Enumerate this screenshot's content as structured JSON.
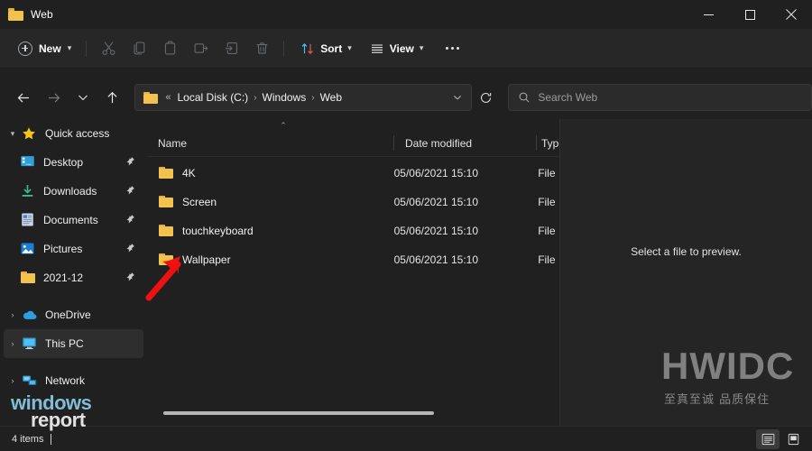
{
  "window": {
    "title": "Web",
    "title_icon": "folder-icon",
    "controls": {
      "minimize": "minimize-icon",
      "maximize": "maximize-icon",
      "close": "close-icon"
    }
  },
  "toolbar": {
    "new_label": "New",
    "new_icon": "plus-circle-icon",
    "new_chevron": "⌄",
    "actions": [
      {
        "name": "cut-button",
        "icon": "scissors-icon",
        "label": "Cut",
        "disabled": true
      },
      {
        "name": "copy-button",
        "icon": "copy-icon",
        "label": "Copy",
        "disabled": true
      },
      {
        "name": "paste-button",
        "icon": "clipboard-icon",
        "label": "Paste",
        "disabled": true
      },
      {
        "name": "rename-button",
        "icon": "rename-icon",
        "label": "Rename",
        "disabled": true
      },
      {
        "name": "share-button",
        "icon": "share-icon",
        "label": "Share",
        "disabled": true
      },
      {
        "name": "delete-button",
        "icon": "trash-icon",
        "label": "Delete",
        "disabled": true
      }
    ],
    "sort_label": "Sort",
    "sort_icon": "sort-arrows-icon",
    "view_label": "View",
    "view_icon": "list-lines-icon",
    "overflow_label": "See more",
    "overflow_icon": "ellipsis-icon"
  },
  "address": {
    "back_icon": "arrow-left-icon",
    "forward_icon": "arrow-right-icon",
    "recent_icon": "chevron-down-icon",
    "up_icon": "arrow-up-icon",
    "folder_icon": "folder-icon",
    "overflow": "«",
    "crumbs": [
      "Local Disk (C:)",
      "Windows",
      "Web"
    ],
    "separator": "›",
    "dropdown_icon": "chevron-down-icon",
    "refresh_icon": "refresh-icon"
  },
  "search": {
    "icon": "search-icon",
    "placeholder": "Search Web",
    "value": ""
  },
  "sidebar": {
    "items": [
      {
        "label": "Quick access",
        "icon": "star-icon",
        "expander": "⌄",
        "expanded": true,
        "pinned": false,
        "child": false,
        "selected": false
      },
      {
        "label": "Desktop",
        "icon": "desktop-icon",
        "expander": "",
        "pinned": true,
        "child": true,
        "selected": false
      },
      {
        "label": "Downloads",
        "icon": "download-icon",
        "expander": "",
        "pinned": true,
        "child": true,
        "selected": false
      },
      {
        "label": "Documents",
        "icon": "document-icon",
        "expander": "",
        "pinned": true,
        "child": true,
        "selected": false
      },
      {
        "label": "Pictures",
        "icon": "pictures-icon",
        "expander": "",
        "pinned": true,
        "child": true,
        "selected": false
      },
      {
        "label": "2021-12",
        "icon": "folder-icon",
        "expander": "",
        "pinned": true,
        "child": true,
        "selected": false
      },
      {
        "label": "OneDrive",
        "icon": "cloud-icon",
        "expander": "›",
        "pinned": false,
        "child": false,
        "selected": false
      },
      {
        "label": "This PC",
        "icon": "monitor-icon",
        "expander": "›",
        "pinned": false,
        "child": false,
        "selected": true
      },
      {
        "label": "Network",
        "icon": "network-icon",
        "expander": "›",
        "pinned": false,
        "child": false,
        "selected": false
      }
    ],
    "pin_icon": "pin-icon"
  },
  "filelist": {
    "sort_indicator": "⌃",
    "sort_column": "Name",
    "sort_direction": "ascending",
    "columns": [
      {
        "key": "name",
        "label": "Name"
      },
      {
        "key": "date",
        "label": "Date modified"
      },
      {
        "key": "type",
        "label": "Type"
      }
    ],
    "rows": [
      {
        "icon": "folder-icon",
        "name": "4K",
        "date": "05/06/2021 15:10",
        "type": "File f"
      },
      {
        "icon": "folder-icon",
        "name": "Screen",
        "date": "05/06/2021 15:10",
        "type": "File f"
      },
      {
        "icon": "folder-icon",
        "name": "touchkeyboard",
        "date": "05/06/2021 15:10",
        "type": "File f"
      },
      {
        "icon": "folder-icon",
        "name": "Wallpaper",
        "date": "05/06/2021 15:10",
        "type": "File f"
      }
    ]
  },
  "preview": {
    "message": "Select a file to preview."
  },
  "statusbar": {
    "item_count": "4 items",
    "details_view_icon": "details-view-icon",
    "large_icons_view_icon": "large-icons-view-icon",
    "active_view": "details-view-icon"
  },
  "annotations": {
    "arrow_color": "#ee1111",
    "arrow_target": "Wallpaper"
  },
  "watermarks": {
    "brand": "HWIDC",
    "brand_sub": "至真至诚 品质保住",
    "site_line1": "windows",
    "site_line2": "report"
  },
  "colors": {
    "window_bg": "#202020",
    "toolbar_bg": "#272727",
    "preview_bg": "#252525",
    "folder_yellow": "#f2c14e",
    "accent_blue": "#4cc2ff",
    "text": "#f0f0f0",
    "text_muted": "#9d9d9d",
    "arrow_red": "#ee1111"
  }
}
